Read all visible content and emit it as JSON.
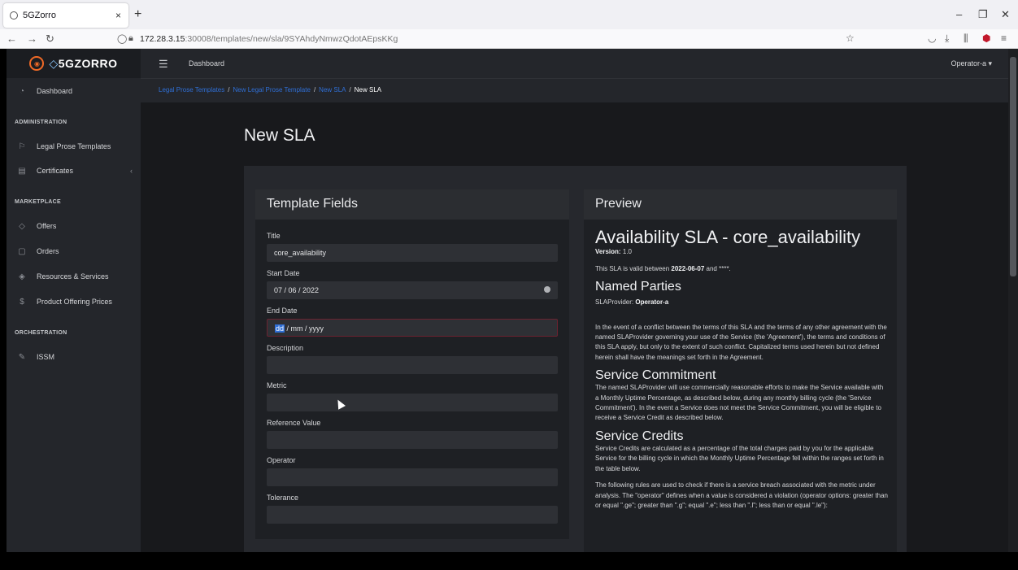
{
  "browser": {
    "tab_title": "5GZorro",
    "tab_close": "×",
    "new_tab": "+",
    "url_host": "172.28.3.15",
    "url_path": ":30008/templates/new/sla/9SYAhdyNmwzQdotAEpsKKg"
  },
  "app": {
    "logo_text": "5GZORRO",
    "topbar_dashboard": "Dashboard",
    "user_menu": "Operator-a ▾"
  },
  "sidebar": {
    "dashboard": "Dashboard",
    "sections": {
      "administration": "ADMINISTRATION",
      "marketplace": "MARKETPLACE",
      "orchestration": "ORCHESTRATION"
    },
    "items": {
      "legal": "Legal Prose Templates",
      "certificates": "Certificates",
      "offers": "Offers",
      "orders": "Orders",
      "resources": "Resources & Services",
      "prices": "Product Offering Prices",
      "issm": "ISSM"
    }
  },
  "breadcrumb": {
    "c1": "Legal Prose Templates",
    "c2": "New Legal Prose Template",
    "c3": "New SLA",
    "current": "New SLA"
  },
  "page": {
    "title": "New SLA"
  },
  "form": {
    "header": "Template Fields",
    "title_label": "Title",
    "title_value": "core_availability",
    "start_label": "Start Date",
    "start_value": "07 / 06 / 2022",
    "end_label": "End Date",
    "end_dd": "dd",
    "end_rest": " / mm / yyyy",
    "description_label": "Description",
    "metric_label": "Metric",
    "reference_label": "Reference Value",
    "operator_label": "Operator",
    "tolerance_label": "Tolerance"
  },
  "preview": {
    "header": "Preview",
    "doc_title": "Availability SLA - core_availability",
    "version_label": "Version:",
    "version_value": "1.0",
    "valid_pre": "This SLA is valid between ",
    "valid_start": "2022-06-07",
    "valid_post": " and ****.",
    "parties_heading": "Named Parties",
    "provider_label": "SLAProvider: ",
    "provider_value": "Operator-a",
    "conflict_para": "In the event of a conflict between the terms of this SLA and the terms of any other agreement with the named SLAProvider governing your use of the Service (the 'Agreement'), the terms and conditions of this SLA apply, but only to the extent of such conflict. Capitalized terms used herein but not defined herein shall have the meanings set forth in the Agreement.",
    "commitment_heading": "Service Commitment",
    "commitment_para": "The named SLAProvider will use commercially reasonable efforts to make the Service available with a Monthly Uptime Percentage, as described below, during any monthly billing cycle (the 'Service Commitment'). In the event a Service does not meet the Service Commitment, you will be eligible to receive a Service Credit as described below.",
    "credits_heading": "Service Credits",
    "credits_para": "Service Credits are calculated as a percentage of the total charges paid by you for the applicable Service for the billing cycle in which the Monthly Uptime Percentage fell within the ranges set forth in the table below.",
    "rules_para": "The following rules are used to check if there is a service breach associated with the metric under analysis. The \"operator\" defines when a value is considered a violation (operator options: greater than or equal \".ge\"; greater than \".g\"; equal \".e\"; less than \".l\"; less than or equal \".le\"):"
  }
}
